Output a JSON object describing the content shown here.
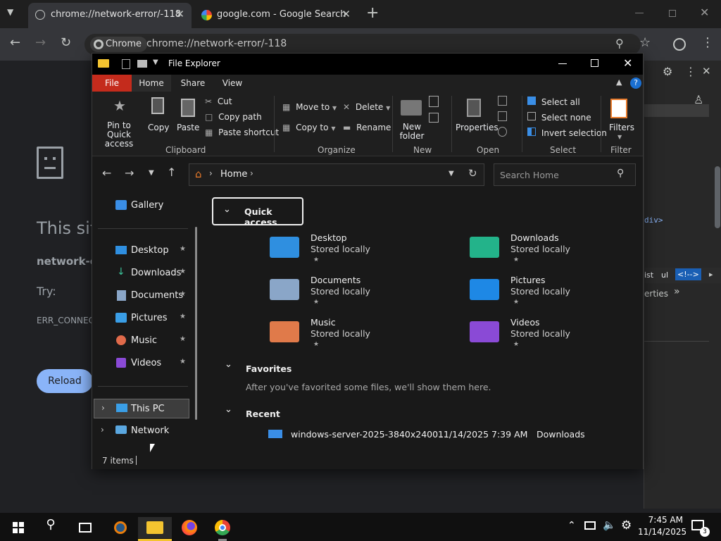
{
  "chrome": {
    "tabs": [
      {
        "title": "chrome://network-error/-118",
        "active": true
      },
      {
        "title": "google.com - Google Search",
        "active": false
      }
    ],
    "chip": "Chrome",
    "url": "chrome://network-error/-118"
  },
  "error_page": {
    "title_partial": "This sit",
    "subtitle_partial": "network-e",
    "try": "Try:",
    "code_partial": "ERR_CONNEC",
    "reload": "Reload"
  },
  "devtools": {
    "code_tag": "div>",
    "tabs": [
      "ist",
      "ul",
      "<!-->"
    ],
    "properties": "erties"
  },
  "explorer": {
    "title": "File Explorer",
    "file_tabs": [
      "File",
      "Home",
      "Share",
      "View"
    ],
    "ribbon": {
      "pin": "Pin to Quick access",
      "copy": "Copy",
      "paste": "Paste",
      "cut": "Cut",
      "copy_path": "Copy path",
      "paste_shortcut": "Paste shortcut",
      "move_to": "Move to",
      "copy_to": "Copy to",
      "delete": "Delete",
      "rename": "Rename",
      "new_folder": "New folder",
      "properties": "Properties",
      "select_all": "Select all",
      "select_none": "Select none",
      "invert_selection": "Invert selection",
      "filters": "Filters",
      "groups": [
        "Clipboard",
        "Organize",
        "New",
        "Open",
        "Select",
        "Filter"
      ]
    },
    "address": {
      "home": "Home"
    },
    "search_placeholder": "Search Home",
    "nav": {
      "gallery": "Gallery",
      "items": [
        "Desktop",
        "Downloads",
        "Documents",
        "Pictures",
        "Music",
        "Videos"
      ],
      "this_pc": "This PC",
      "network": "Network"
    },
    "quick_access_header": "Quick access",
    "quick_access": [
      {
        "name": "Desktop",
        "sub": "Stored locally"
      },
      {
        "name": "Downloads",
        "sub": "Stored locally"
      },
      {
        "name": "Documents",
        "sub": "Stored locally"
      },
      {
        "name": "Pictures",
        "sub": "Stored locally"
      },
      {
        "name": "Music",
        "sub": "Stored locally"
      },
      {
        "name": "Videos",
        "sub": "Stored locally"
      }
    ],
    "favorites_header": "Favorites",
    "favorites_empty": "After you've favorited some files, we'll show them here.",
    "recent_header": "Recent",
    "recent": [
      {
        "name": "windows-server-2025-3840x2400...",
        "date": "11/14/2025 7:39 AM",
        "location": "Downloads"
      }
    ],
    "status": "7 items"
  },
  "taskbar": {
    "time": "7:45 AM",
    "date": "11/14/2025",
    "notif_count": "3"
  },
  "colors": {
    "accent": "#c42b1c",
    "chrome_blue": "#8ab4f8",
    "folder_yellow": "#f4c430"
  }
}
